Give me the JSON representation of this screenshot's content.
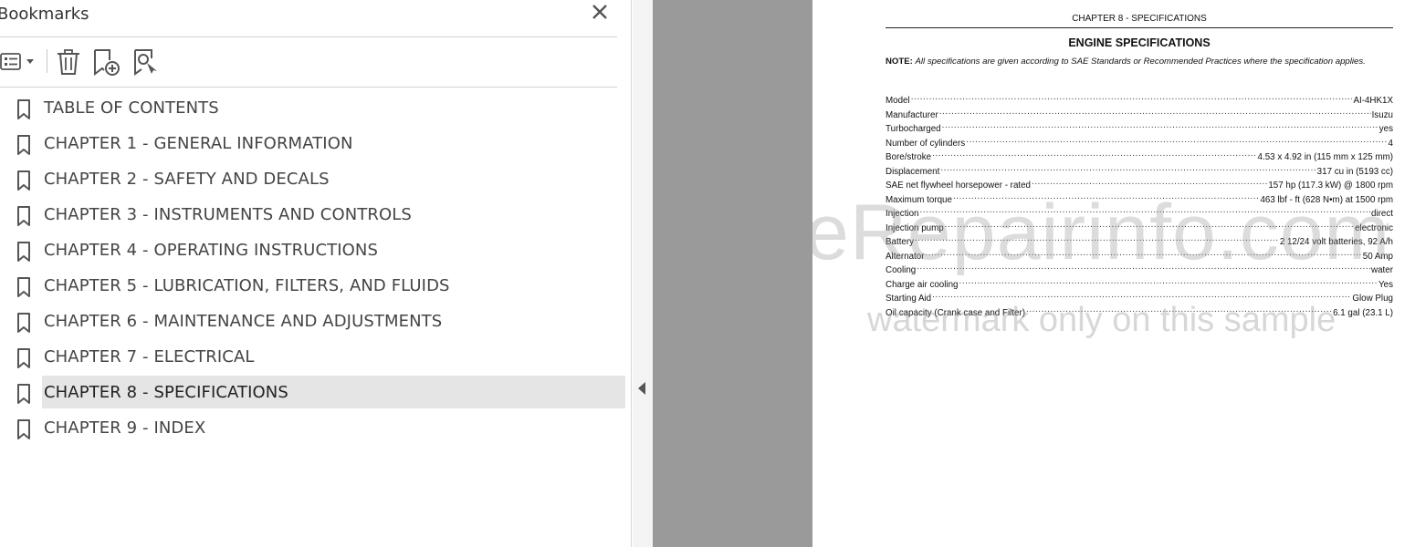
{
  "bookmarks_panel": {
    "title": "Bookmarks",
    "toolbar": {
      "options_icon": "list-options-icon",
      "delete_icon": "trash-icon",
      "add_icon": "add-bookmark-icon",
      "find_icon": "find-current-bookmark-icon"
    },
    "items": [
      {
        "label": "TABLE OF CONTENTS",
        "selected": false
      },
      {
        "label": "CHAPTER 1 - GENERAL INFORMATION",
        "selected": false
      },
      {
        "label": "CHAPTER 2 - SAFETY AND DECALS",
        "selected": false
      },
      {
        "label": "CHAPTER 3 - INSTRUMENTS AND CONTROLS",
        "selected": false
      },
      {
        "label": "CHAPTER 4 - OPERATING INSTRUCTIONS",
        "selected": false
      },
      {
        "label": "CHAPTER 5 - LUBRICATION, FILTERS, AND FLUIDS",
        "selected": false
      },
      {
        "label": "CHAPTER 6 - MAINTENANCE AND ADJUSTMENTS",
        "selected": false
      },
      {
        "label": "CHAPTER 7 - ELECTRICAL",
        "selected": false
      },
      {
        "label": "CHAPTER 8 - SPECIFICATIONS",
        "selected": true
      },
      {
        "label": "CHAPTER 9 - INDEX",
        "selected": false
      }
    ]
  },
  "document": {
    "header": "CHAPTER 8 - SPECIFICATIONS",
    "section_title": "ENGINE SPECIFICATIONS",
    "note_label": "NOTE:",
    "note_text": "All specifications are given according to SAE Standards or Recommended Practices where the specification applies.",
    "specs": [
      {
        "label": "Model",
        "value": "AI-4HK1X"
      },
      {
        "label": "Manufacturer",
        "value": "Isuzu"
      },
      {
        "label": "Turbocharged",
        "value": "yes"
      },
      {
        "label": "Number of cylinders",
        "value": "4"
      },
      {
        "label": "Bore/stroke",
        "value": "4.53 x 4.92 in (115 mm x 125 mm)"
      },
      {
        "label": "Displacement",
        "value": "317 cu in (5193 cc)"
      },
      {
        "label": "SAE net flywheel horsepower - rated",
        "value": "157 hp (117.3 kW) @ 1800 rpm"
      },
      {
        "label": "Maximum torque",
        "value": "463 lbf - ft (628 N•m) at 1500 rpm"
      },
      {
        "label": "Injection",
        "value": "direct"
      },
      {
        "label": "Injection pump",
        "value": "electronic"
      },
      {
        "label": "Battery",
        "value": "2 12/24 volt batteries, 92 A/h"
      },
      {
        "label": "Alternator",
        "value": "50 Amp"
      },
      {
        "label": "Cooling",
        "value": "water"
      },
      {
        "label": "Charge air cooling",
        "value": "Yes"
      },
      {
        "label": "Starting Aid",
        "value": "Glow Plug"
      },
      {
        "label": "Oil capacity (Crank case and Filter)",
        "value": "6.1 gal (23.1 L)"
      }
    ],
    "watermark_main": "eRepairinfo.com",
    "watermark_sub": "watermark only on this sample"
  },
  "colors": {
    "gutter": "#9a9a9a",
    "selected_row": "#e5e5e5"
  }
}
